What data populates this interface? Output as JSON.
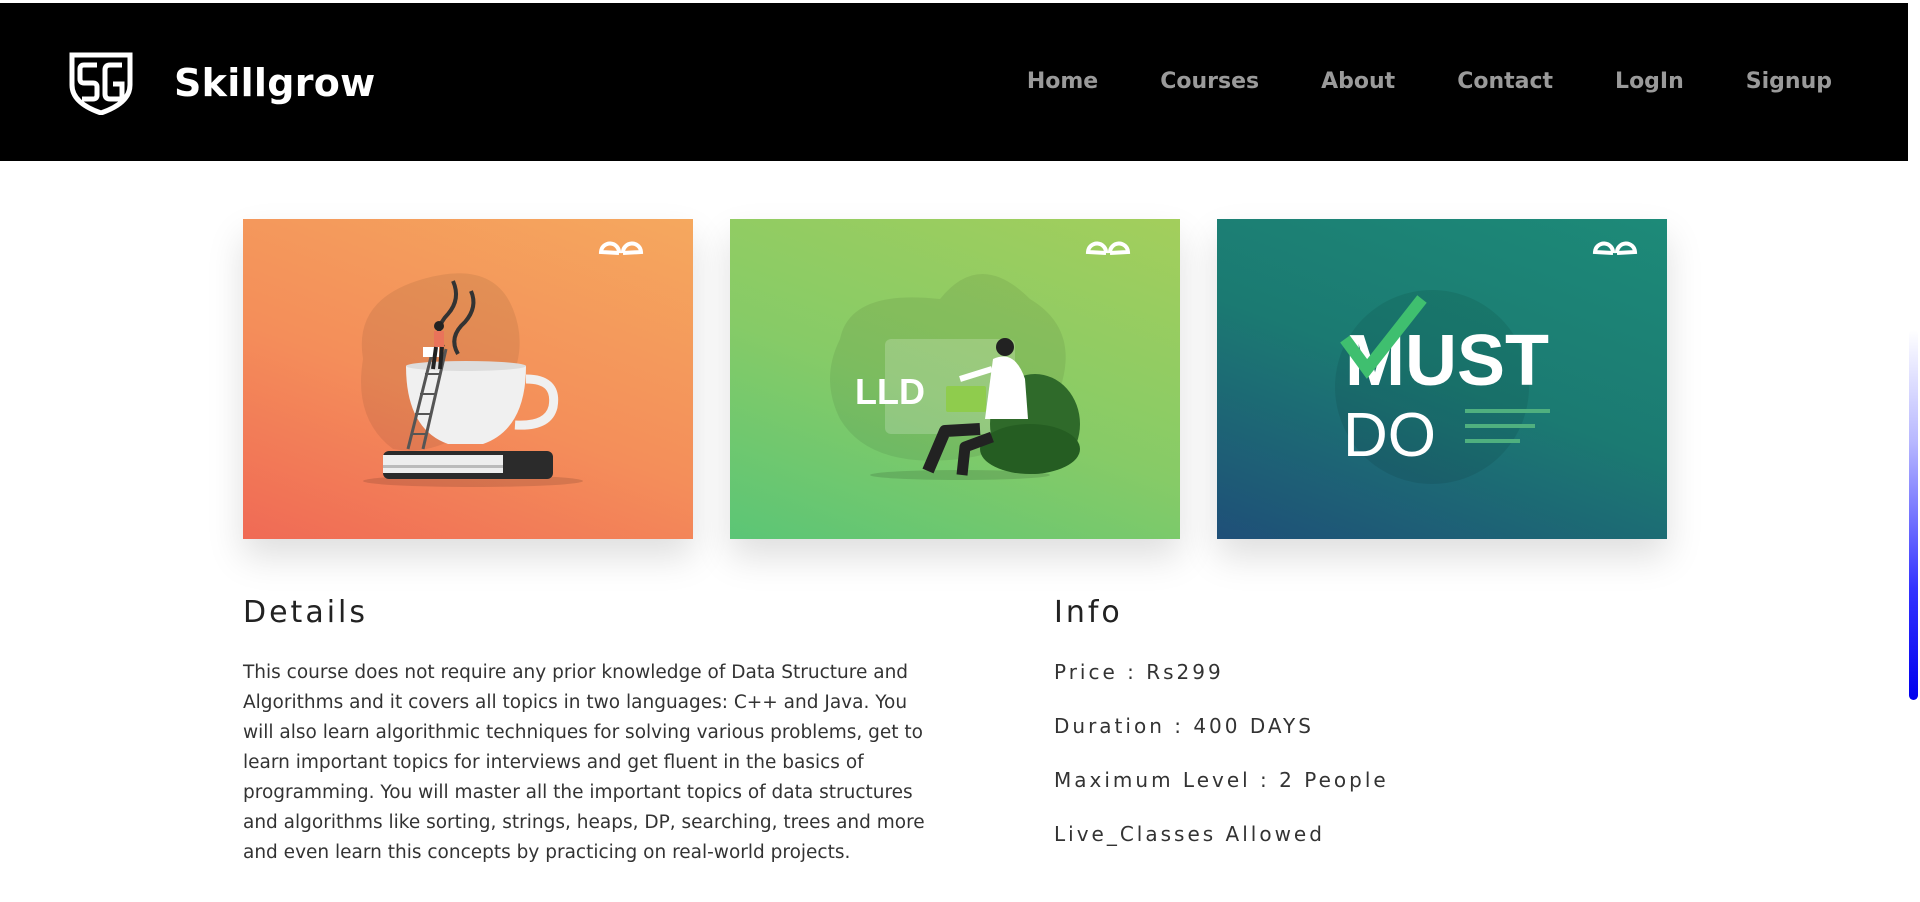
{
  "header": {
    "brand_name": "Skillgrow",
    "nav": [
      "Home",
      "Courses",
      "About",
      "Contact",
      "LogIn",
      "Signup"
    ]
  },
  "cards": [
    {
      "icon": "coffee-cup-illustration",
      "logo": "gfg-logo"
    },
    {
      "icon": "lld-illustration",
      "label": "LLD",
      "logo": "gfg-logo"
    },
    {
      "icon": "must-do-illustration",
      "label_top": "MUST",
      "label_bottom": "DO",
      "logo": "gfg-logo"
    }
  ],
  "details": {
    "title": "Details",
    "text": "This course does not require any prior knowledge of Data Structure and Algorithms and it covers all topics in two languages: C++ and Java. You will also learn algorithmic techniques for solving various problems, get to learn important topics for interviews and get fluent in the basics of programming. You will master all the important topics of data structures and algorithms like sorting, strings, heaps, DP, searching, trees and more and even learn this concepts by practicing on real-world projects."
  },
  "info": {
    "title": "Info",
    "rows": [
      "Price : Rs299",
      "Duration : 400 DAYS",
      "Maximum Level : 2 People",
      "Live_Classes Allowed"
    ]
  },
  "colors": {
    "navbar": "#000000",
    "nav_link": "#9a9a9a",
    "scroll_thumb": "#0000ee"
  }
}
